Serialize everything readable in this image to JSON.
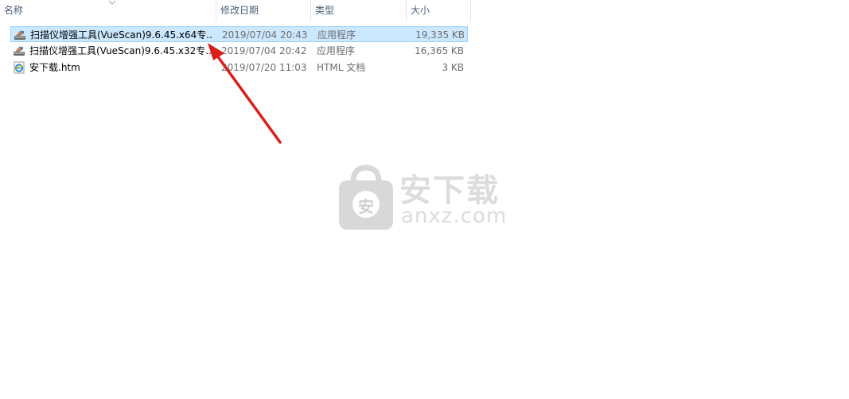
{
  "columns": {
    "name": "名称",
    "date": "修改日期",
    "type": "类型",
    "size": "大小"
  },
  "files": [
    {
      "name": "扫描仪增强工具(VueScan)9.6.45.x64专...",
      "date": "2019/07/04 20:43",
      "type": "应用程序",
      "size": "19,335 KB",
      "icon": "scanner-app-icon",
      "selected": true
    },
    {
      "name": "扫描仪增强工具(VueScan)9.6.45.x32专...",
      "date": "2019/07/04 20:42",
      "type": "应用程序",
      "size": "16,365 KB",
      "icon": "scanner-app-icon",
      "selected": false
    },
    {
      "name": "安下载.htm",
      "date": "2019/07/20 11:03",
      "type": "HTML 文档",
      "size": "3 KB",
      "icon": "html-document-icon",
      "selected": false
    }
  ],
  "watermark": {
    "cn": "安下载",
    "en": "anxz.com",
    "badge": "安"
  },
  "colors": {
    "selection_bg": "#cce8ff",
    "selection_border": "#99d1ff",
    "header_text": "#4c607a",
    "arrow": "#e0201e",
    "watermark": "#dcdcdc"
  }
}
